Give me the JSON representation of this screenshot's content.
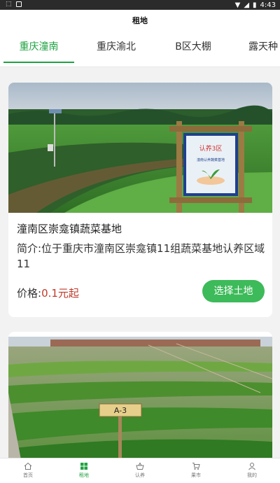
{
  "status_bar": {
    "time": "4:43"
  },
  "header": {
    "title": "租地"
  },
  "tabs": [
    {
      "label": "重庆潼南",
      "active": true
    },
    {
      "label": "重庆渝北",
      "active": false
    },
    {
      "label": "B区大棚",
      "active": false
    },
    {
      "label": "露天种",
      "active": false
    }
  ],
  "cards": [
    {
      "name": "潼南区崇龛镇蔬菜基地",
      "desc": "简介:位于重庆市潼南区崇龛镇11组蔬菜基地认养区域11",
      "price_label": "价格:",
      "price_value": "0.1元起",
      "button": "选择土地",
      "sign_title": "认养3区",
      "sign_sub": "潼南认养蔬菜基地"
    },
    {
      "sign_label": "A-3"
    }
  ],
  "bottom_nav": [
    {
      "label": "首页",
      "icon": "home-icon"
    },
    {
      "label": "租地",
      "icon": "grid-icon",
      "active": true
    },
    {
      "label": "认养",
      "icon": "basket-icon"
    },
    {
      "label": "果市",
      "icon": "cart-icon"
    },
    {
      "label": "我的",
      "icon": "user-icon"
    }
  ],
  "colors": {
    "accent": "#1fa342",
    "button": "#3dba5a",
    "price": "#c0392b"
  }
}
